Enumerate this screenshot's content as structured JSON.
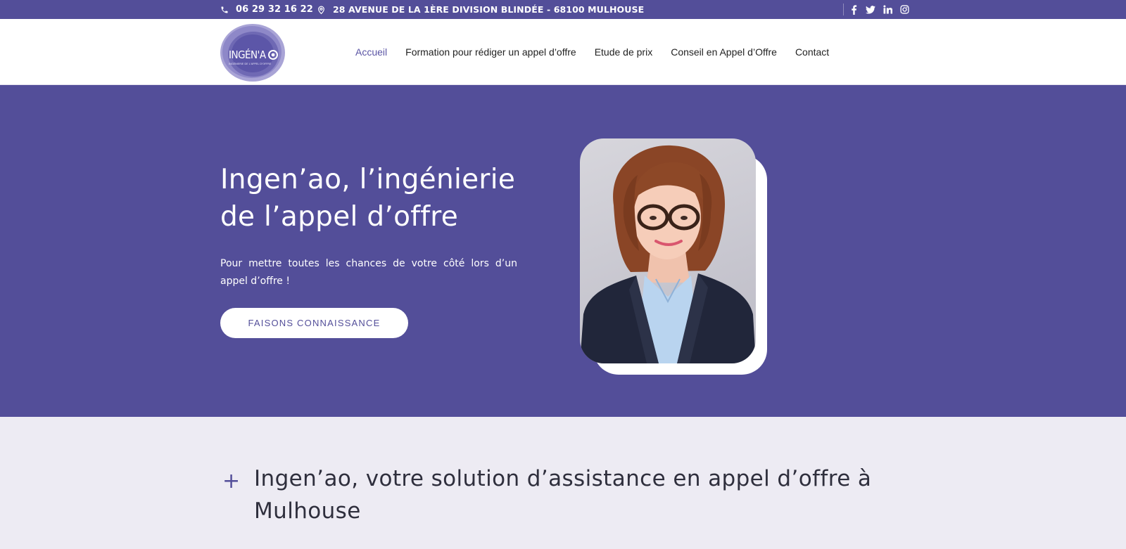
{
  "topbar": {
    "phone": "06 29 32 16 22",
    "address": "28 AVENUE DE LA 1ÈRE DIVISION BLINDÉE - 68100 MULHOUSE",
    "socials": [
      "facebook-icon",
      "twitter-icon",
      "linkedin-icon",
      "instagram-icon"
    ]
  },
  "header": {
    "logo_text": "INGÉN'AO",
    "logo_subtext": "INGÉNIERIE DE L'APPEL D'OFFRE",
    "nav": [
      {
        "label": "Accueil",
        "active": true
      },
      {
        "label": "Formation pour rédiger un appel d’offre"
      },
      {
        "label": "Etude de prix"
      },
      {
        "label": "Conseil en Appel d’Offre"
      },
      {
        "label": "Contact"
      }
    ]
  },
  "hero": {
    "title": "Ingen’ao, l’ingénierie de l’appel d’offre",
    "subtitle": "Pour mettre toutes les chances de votre côté lors d’un appel d’offre !",
    "cta_label": "FAISONS CONNAISSANCE"
  },
  "section": {
    "heading": "Ingen’ao, votre solution d’assistance en appel d’offre à Mulhouse"
  },
  "colors": {
    "brand": "#534e99",
    "accent_text": "#5a54a4",
    "section_bg": "#edebf3"
  }
}
